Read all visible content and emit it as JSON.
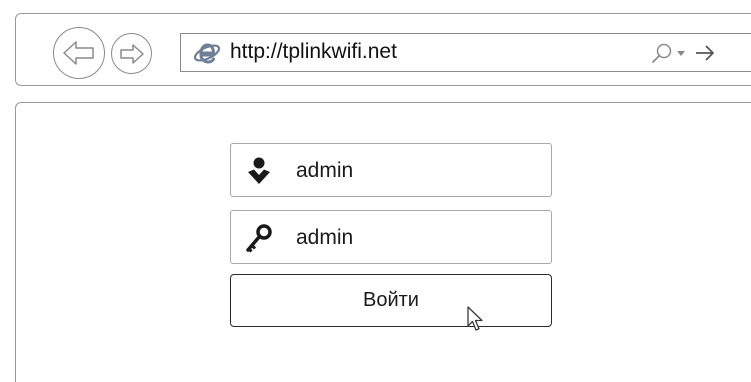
{
  "browser": {
    "url": "http://tplinkwifi.net",
    "icons": {
      "back": "back-arrow-icon",
      "forward": "forward-arrow-icon",
      "page": "internet-explorer-icon",
      "search": "search-icon",
      "dropdown": "dropdown-triangle-icon",
      "go": "go-arrow-icon"
    }
  },
  "login": {
    "username_value": "admin",
    "password_value": "admin",
    "button_label": "Войти",
    "icons": {
      "username": "user-icon",
      "password": "key-icon"
    }
  },
  "colors": {
    "frame_border": "#9a9a9a",
    "field_border": "#a8a8a8",
    "button_border": "#2a2a2a",
    "ie_blue": "#6f7f96"
  }
}
